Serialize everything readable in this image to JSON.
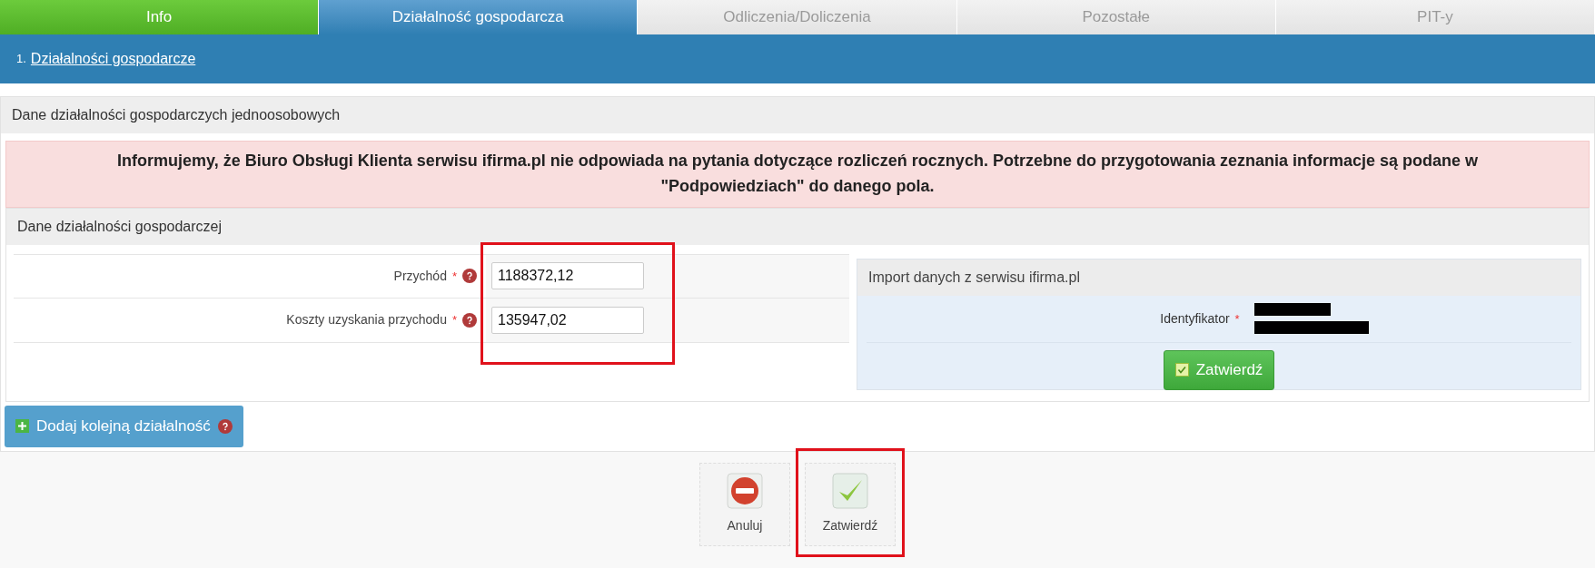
{
  "tabs": [
    {
      "label": "Info",
      "selected": false,
      "completed": true
    },
    {
      "label": "Działalność gospodarcza",
      "selected": true,
      "completed": false
    },
    {
      "label": "Odliczenia/Doliczenia",
      "selected": false,
      "completed": false
    },
    {
      "label": "Pozostałe",
      "selected": false,
      "completed": false
    },
    {
      "label": "PIT-y",
      "selected": false,
      "completed": false
    }
  ],
  "breadcrumb": {
    "number": "1.",
    "link": "Działalności gospodarcze"
  },
  "section": {
    "title": "Dane działalności gospodarczych jednoosobowych",
    "notice": "Informujemy, że Biuro Obsługi Klienta serwisu ifirma.pl nie odpowiada na pytania dotyczące rozliczeń rocznych. Potrzebne do przygotowania zeznania informacje są podane w \"Podpowiedziach\" do danego pola.",
    "panel": {
      "title": "Dane działalności gospodarczej",
      "fields": [
        {
          "label": "Przychód",
          "required_mark": "*",
          "help": true,
          "value": "1188372,12"
        },
        {
          "label": "Koszty uzyskania przychodu",
          "required_mark": "*",
          "help": true,
          "value": "135947,02"
        }
      ],
      "fields_highlighted": true,
      "import": {
        "title": "Import danych z serwisu ifirma.pl",
        "label": "Identyfikator",
        "required_mark": "*",
        "redacted": true,
        "button": "Zatwierdź"
      }
    },
    "add_button": {
      "label": "Dodaj kolejną działalność",
      "help": true
    }
  },
  "footer_buttons": [
    {
      "kind": "cancel",
      "label": "Anuluj",
      "highlighted": false
    },
    {
      "kind": "confirm",
      "label": "Zatwierdź",
      "highlighted": true
    }
  ]
}
